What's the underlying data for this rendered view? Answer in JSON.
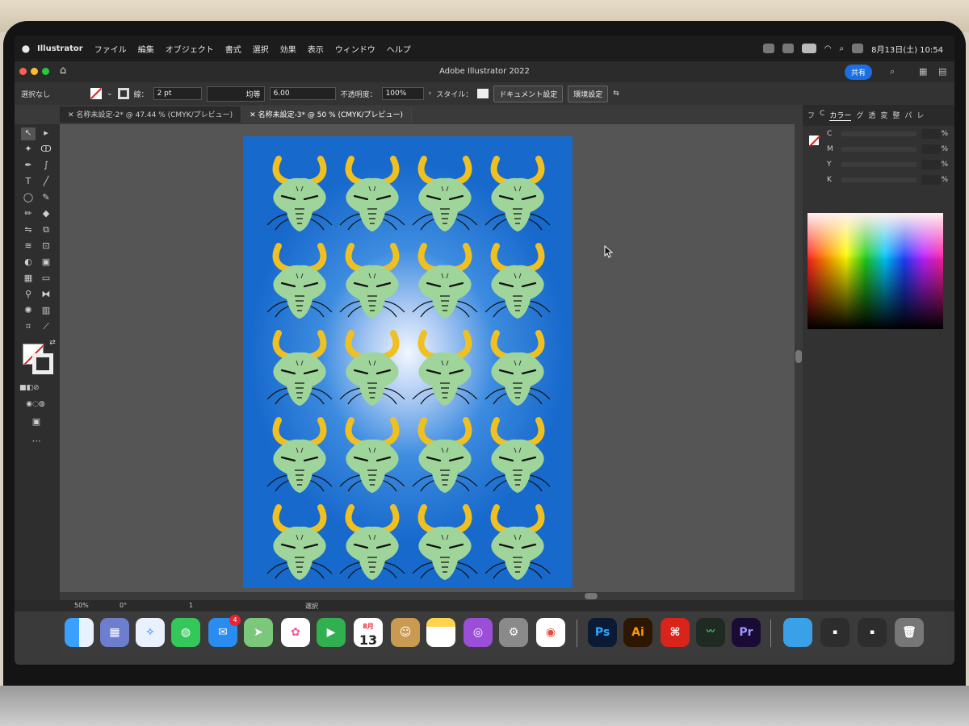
{
  "menubar": {
    "app_name": "Illustrator",
    "items": [
      "ファイル",
      "編集",
      "オブジェクト",
      "書式",
      "選択",
      "効果",
      "表示",
      "ウィンドウ",
      "ヘルプ"
    ],
    "clock": "8月13日(土) 10:54"
  },
  "window": {
    "title": "Adobe Illustrator 2022",
    "share_label": "共有"
  },
  "control_bar": {
    "selection": "選択なし",
    "stroke_label": "線：",
    "stroke_weight": "2 pt",
    "stroke_profile": "均等",
    "brush_size": "6.00",
    "opacity_label": "不透明度：",
    "opacity_value": "100%",
    "style_label": "スタイル：",
    "document_settings": "ドキュメント設定",
    "preferences": "環境設定"
  },
  "tabs": [
    {
      "label": "名称未設定-2* @ 47.44 % (CMYK/プレビュー)",
      "active": false
    },
    {
      "label": "名称未設定-3* @ 50 % (CMYK/プレビュー)",
      "active": true
    }
  ],
  "color_panel": {
    "tabs": [
      "フ",
      "C",
      "カラー",
      "グ",
      "透",
      "変",
      "整",
      "パ",
      "レ"
    ],
    "active_tab": "カラー",
    "channels": [
      "C",
      "M",
      "Y",
      "K"
    ],
    "unit": "%"
  },
  "status_bar": {
    "zoom": "50%",
    "rotation": "0°",
    "artboard": "1",
    "mode": "選択"
  },
  "dock": {
    "calendar_month": "8月",
    "calendar_day": "13",
    "mail_badge": "4",
    "ps_label": "Ps",
    "ai_label": "Ai",
    "pr_label": "Pr"
  },
  "artwork": {
    "rows": 5,
    "columns": 4,
    "colors": {
      "face": "#9fd59a",
      "horn": "#f0c020",
      "background": "#1769cc"
    }
  }
}
